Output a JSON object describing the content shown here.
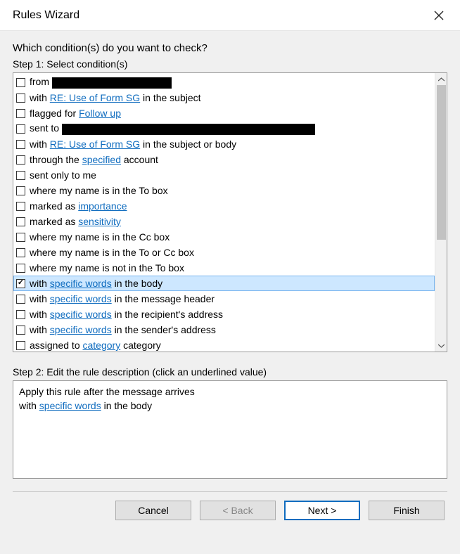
{
  "window": {
    "title": "Rules Wizard"
  },
  "question": "Which condition(s) do you want to check?",
  "step1_label": "Step 1: Select condition(s)",
  "step2_label": "Step 2: Edit the rule description (click an underlined value)",
  "conditions": [
    {
      "checked": false,
      "selected": false,
      "parts": [
        {
          "t": "from "
        },
        {
          "redact": 170
        }
      ]
    },
    {
      "checked": false,
      "selected": false,
      "parts": [
        {
          "t": "with "
        },
        {
          "link": "RE: Use of Form SG"
        },
        {
          "t": " in the subject"
        }
      ]
    },
    {
      "checked": false,
      "selected": false,
      "parts": [
        {
          "t": "flagged for "
        },
        {
          "link": "Follow up"
        }
      ]
    },
    {
      "checked": false,
      "selected": false,
      "parts": [
        {
          "t": "sent to "
        },
        {
          "redact": 360
        }
      ]
    },
    {
      "checked": false,
      "selected": false,
      "parts": [
        {
          "t": "with "
        },
        {
          "link": "RE: Use of Form SG"
        },
        {
          "t": " in the subject or body"
        }
      ]
    },
    {
      "checked": false,
      "selected": false,
      "parts": [
        {
          "t": "through the "
        },
        {
          "link": "specified"
        },
        {
          "t": " account"
        }
      ]
    },
    {
      "checked": false,
      "selected": false,
      "parts": [
        {
          "t": "sent only to me"
        }
      ]
    },
    {
      "checked": false,
      "selected": false,
      "parts": [
        {
          "t": "where my name is in the To box"
        }
      ]
    },
    {
      "checked": false,
      "selected": false,
      "parts": [
        {
          "t": "marked as "
        },
        {
          "link": "importance"
        }
      ]
    },
    {
      "checked": false,
      "selected": false,
      "parts": [
        {
          "t": "marked as "
        },
        {
          "link": "sensitivity"
        }
      ]
    },
    {
      "checked": false,
      "selected": false,
      "parts": [
        {
          "t": "where my name is in the Cc box"
        }
      ]
    },
    {
      "checked": false,
      "selected": false,
      "parts": [
        {
          "t": "where my name is in the To or Cc box"
        }
      ]
    },
    {
      "checked": false,
      "selected": false,
      "parts": [
        {
          "t": "where my name is not in the To box"
        }
      ]
    },
    {
      "checked": true,
      "selected": true,
      "parts": [
        {
          "t": "with "
        },
        {
          "link": "specific words"
        },
        {
          "t": " in the body"
        }
      ]
    },
    {
      "checked": false,
      "selected": false,
      "parts": [
        {
          "t": "with "
        },
        {
          "link": "specific words"
        },
        {
          "t": " in the message header"
        }
      ]
    },
    {
      "checked": false,
      "selected": false,
      "parts": [
        {
          "t": "with "
        },
        {
          "link": "specific words"
        },
        {
          "t": " in the recipient's address"
        }
      ]
    },
    {
      "checked": false,
      "selected": false,
      "parts": [
        {
          "t": "with "
        },
        {
          "link": "specific words"
        },
        {
          "t": " in the sender's address"
        }
      ]
    },
    {
      "checked": false,
      "selected": false,
      "parts": [
        {
          "t": "assigned to "
        },
        {
          "link": "category"
        },
        {
          "t": " category"
        }
      ]
    }
  ],
  "description": {
    "line1": "Apply this rule after the message arrives",
    "line2_prefix": "with ",
    "line2_link": "specific words",
    "line2_suffix": " in the body"
  },
  "buttons": {
    "cancel": "Cancel",
    "back": "< Back",
    "next": "Next >",
    "finish": "Finish"
  }
}
